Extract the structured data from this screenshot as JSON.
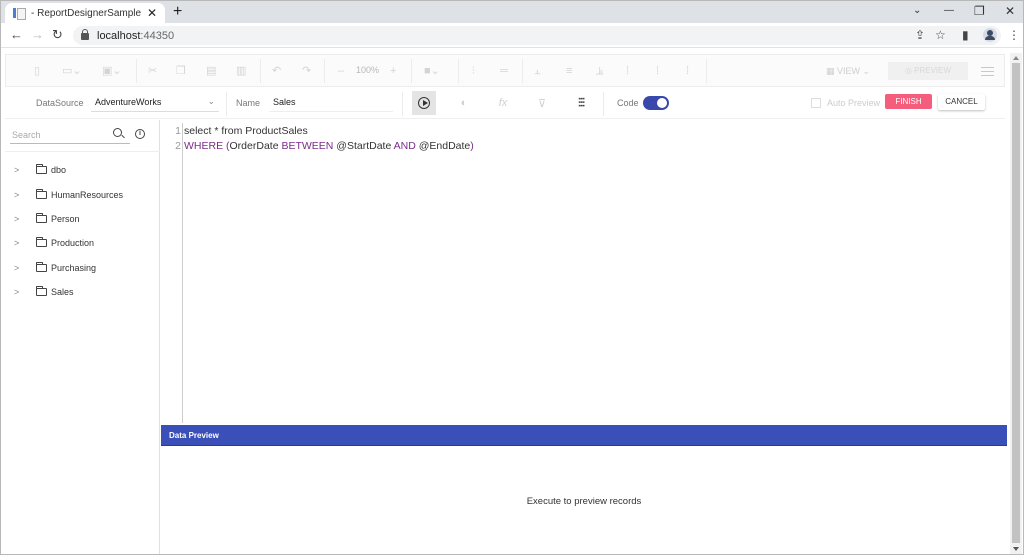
{
  "browser": {
    "tab_title": "- ReportDesignerSample",
    "tab_close": "✕",
    "new_tab": "+",
    "url_host": "localhost",
    "url_port": ":44350",
    "controls": {
      "tab_search": "⌄",
      "minimize": "—",
      "restore": "❐",
      "close": "✕"
    },
    "nav": {
      "back": "←",
      "forward": "→",
      "reload": "↻"
    },
    "addr_icons": {
      "share": "⇪",
      "bookmark": "☆",
      "sidepanel": "▮",
      "menu": "⋮"
    }
  },
  "toolbar": {
    "zoom_level": "100%",
    "view_label": "VIEW",
    "preview_label": "PREVIEW",
    "icons": [
      "new-file-icon",
      "open-folder-icon",
      "save-icon",
      "cut-icon",
      "copy-icon",
      "paste-icon",
      "delete-icon",
      "undo-icon",
      "redo-icon",
      "zoom-out-icon",
      "zoom-in-icon",
      "fill-color-icon",
      "align-left-icon",
      "align-center-icon",
      "align-top-icon",
      "align-middle-icon",
      "align-bottom-icon",
      "distribute-left-icon",
      "distribute-center-icon",
      "distribute-right-icon"
    ]
  },
  "query_bar": {
    "datasource_label": "DataSource",
    "datasource_value": "AdventureWorks",
    "name_label": "Name",
    "name_value": "Sales",
    "code_label": "Code",
    "code_enabled": true,
    "auto_preview_label": "Auto Preview",
    "auto_preview_checked": false,
    "finish_label": "FINISH",
    "cancel_label": "CANCEL",
    "finish_color": "#f45e7c",
    "toggle_color": "#3949ab"
  },
  "schema_panel": {
    "search_placeholder": "Search",
    "items": [
      {
        "label": "dbo"
      },
      {
        "label": "HumanResources"
      },
      {
        "label": "Person"
      },
      {
        "label": "Production"
      },
      {
        "label": "Purchasing"
      },
      {
        "label": "Sales"
      }
    ]
  },
  "editor": {
    "line_numbers": [
      "1",
      "2"
    ],
    "lines": [
      {
        "tokens": [
          {
            "t": "select * from ProductSales",
            "c": ""
          }
        ]
      },
      {
        "tokens": [
          {
            "t": "WHERE",
            "c": "kw"
          },
          {
            "t": " ",
            "c": ""
          },
          {
            "t": "(",
            "c": "br"
          },
          {
            "t": "OrderDate ",
            "c": ""
          },
          {
            "t": "BETWEEN",
            "c": "kw"
          },
          {
            "t": " @StartDate ",
            "c": ""
          },
          {
            "t": "AND",
            "c": "kw"
          },
          {
            "t": " @EndDate",
            "c": ""
          },
          {
            "t": ")",
            "c": "br"
          }
        ]
      }
    ]
  },
  "data_preview": {
    "title": "Data Preview",
    "empty_message": "Execute to preview records",
    "header_color": "#3a4fb8"
  }
}
